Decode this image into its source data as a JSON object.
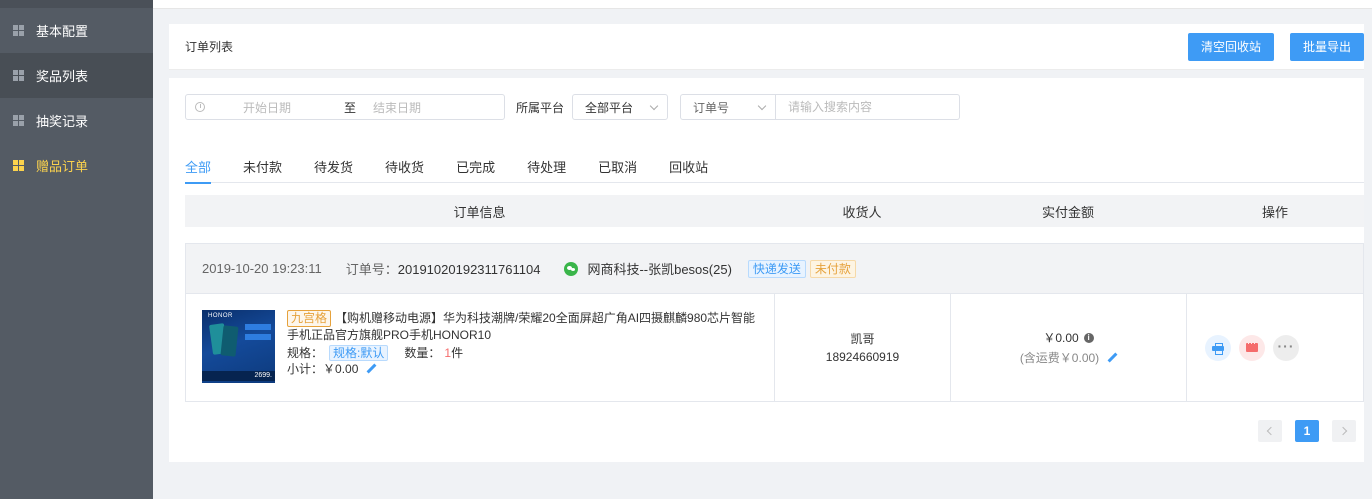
{
  "sidebar": {
    "items": [
      {
        "label": "基本配置"
      },
      {
        "label": "奖品列表"
      },
      {
        "label": "抽奖记录"
      },
      {
        "label": "赠品订单"
      }
    ]
  },
  "panel": {
    "title": "订单列表",
    "clear_recycle_label": "清空回收站",
    "batch_export_label": "批量导出"
  },
  "filters": {
    "start_placeholder": "开始日期",
    "range_separator": "至",
    "end_placeholder": "结束日期",
    "platform_label": "所属平台",
    "platform_value": "全部平台",
    "order_field_value": "订单号",
    "search_placeholder": "请输入搜索内容"
  },
  "tabs": [
    {
      "label": "全部",
      "active": true
    },
    {
      "label": "未付款"
    },
    {
      "label": "待发货"
    },
    {
      "label": "待收货"
    },
    {
      "label": "已完成"
    },
    {
      "label": "待处理"
    },
    {
      "label": "已取消"
    },
    {
      "label": "回收站"
    }
  ],
  "table": {
    "headers": [
      "订单信息",
      "收货人",
      "实付金额",
      "操作"
    ]
  },
  "order": {
    "time": "2019-10-20 19:23:11",
    "order_no_label": "订单号：",
    "order_no": "20191020192311761104",
    "shop": "网商科技--张凯besos(25)",
    "tag_delivery": "快递发送",
    "tag_status": "未付款",
    "product": {
      "grid_tag": "九宫格",
      "title": "【购机赠移动电源】华为科技潮牌/荣耀20全面屏超广角AI四摄麒麟980芯片智能手机正品官方旗舰PRO手机HONOR10",
      "spec_label": "规格：",
      "spec_value": "规格:默认",
      "qty_label": "数量：",
      "qty_value": "1",
      "qty_unit": "件",
      "subtotal_label": "小计：",
      "subtotal_value": "￥0.00",
      "thumb_brand": "HONOR",
      "thumb_price": "2699."
    },
    "receiver_name": "凯哥",
    "receiver_phone": "18924660919",
    "amount": "￥0.00",
    "shipping": "(含运费￥0.00)"
  },
  "pager": {
    "current": "1"
  },
  "colors": {
    "accent": "#3e9bf5",
    "sidebar_bg": "#545b64",
    "selected_menu": "#fcd34d",
    "warning": "#e6a23c",
    "danger": "#f56c6c"
  }
}
